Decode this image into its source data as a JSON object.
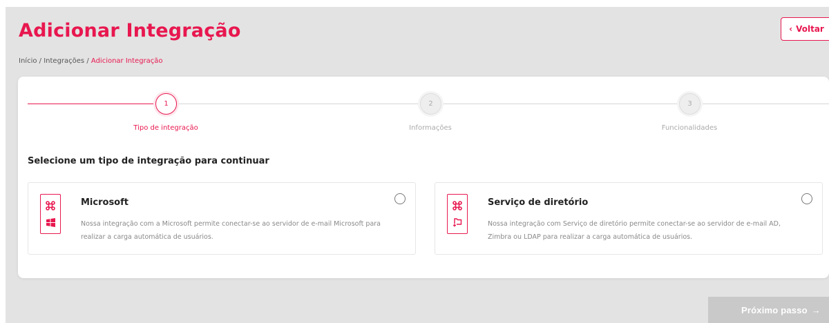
{
  "header": {
    "title": "Adicionar Integração",
    "back_label": "Voltar",
    "back_icon": "chevron-left-icon"
  },
  "breadcrumb": {
    "items": [
      "Início",
      "Integrações"
    ],
    "separator": "/",
    "current": "Adicionar Integração"
  },
  "stepper": {
    "steps": [
      {
        "number": "1",
        "label": "Tipo de integração",
        "state": "active"
      },
      {
        "number": "2",
        "label": "Informações",
        "state": "inactive"
      },
      {
        "number": "3",
        "label": "Funcionalidades",
        "state": "inactive"
      }
    ]
  },
  "main": {
    "section_title": "Selecione um tipo de integração para continuar",
    "options": [
      {
        "title": "Microsoft",
        "description": "Nossa integração com a Microsoft permite conectar-se ao servidor de e-mail Microsoft para realizar a carga automática de usuários.",
        "icons": [
          "integration-icon",
          "windows-icon"
        ],
        "selected": false
      },
      {
        "title": "Serviço de diretório",
        "description": "Nossa integração com Serviço de diretório permite conectar-se ao servidor de e-mail AD, Zimbra ou LDAP para realizar a carga automática de usuários.",
        "icons": [
          "integration-icon",
          "folder-add-icon"
        ],
        "selected": false
      }
    ]
  },
  "footer": {
    "next_label": "Próximo passo",
    "next_icon": "arrow-right-icon",
    "next_enabled": false
  },
  "colors": {
    "accent": "#e8174f",
    "background": "#e3e3e3",
    "disabled": "#c9c9c9"
  }
}
